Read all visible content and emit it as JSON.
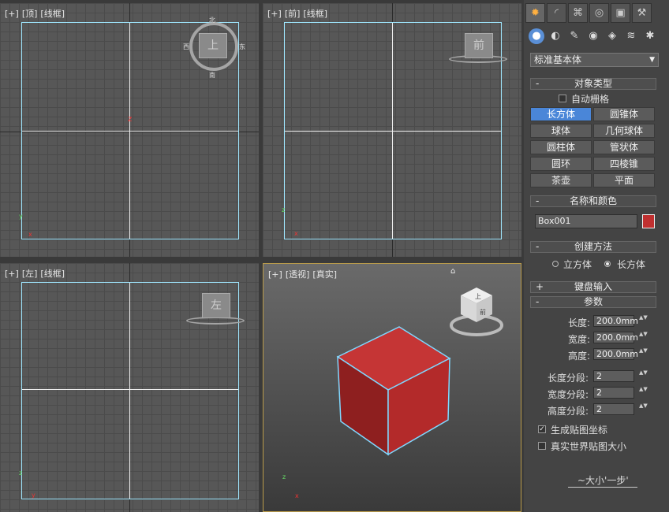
{
  "viewports": {
    "top": {
      "plus": "[+]",
      "view": "[顶]",
      "mode": "[线框]",
      "cube": "上",
      "n": "北",
      "s": "南",
      "w": "西",
      "e": "东"
    },
    "front": {
      "plus": "[+]",
      "view": "[前]",
      "mode": "[线框]",
      "cube": "前"
    },
    "left": {
      "plus": "[+]",
      "view": "[左]",
      "mode": "[线框]",
      "cube": "左"
    },
    "persp": {
      "plus": "[+]",
      "view": "[透视]",
      "mode": "[真实]",
      "cube_top": "上",
      "cube_front": "前"
    }
  },
  "axes": {
    "x": "x",
    "y": "y",
    "z": "z"
  },
  "panel": {
    "tab_icons": [
      "sun-icon",
      "arc-icon",
      "hierarchy-icon",
      "motion-icon",
      "display-icon",
      "hammer-icon"
    ],
    "subtab_icons": [
      "sphere-icon",
      "shapes-icon",
      "light-icon",
      "camera-icon",
      "helper-icon",
      "spacewarp-icon",
      "system-icon"
    ],
    "dropdown": "标准基本体",
    "object_type": {
      "title": "对象类型",
      "autogrid": "自动栅格",
      "buttons": [
        "长方体",
        "圆锥体",
        "球体",
        "几何球体",
        "圆柱体",
        "管状体",
        "圆环",
        "四棱锥",
        "茶壶",
        "平面"
      ]
    },
    "name_color": {
      "title": "名称和颜色",
      "name": "Box001",
      "color": "#c03030"
    },
    "creation": {
      "title": "创建方法",
      "opt1": "立方体",
      "opt2": "长方体"
    },
    "keyboard": {
      "title": "键盘输入"
    },
    "params": {
      "title": "参数",
      "length_label": "长度:",
      "length": "200.0mm",
      "width_label": "宽度:",
      "width": "200.0mm",
      "height_label": "高度:",
      "height": "200.0mm",
      "lseg_label": "长度分段:",
      "lseg": "2",
      "wseg_label": "宽度分段:",
      "wseg": "2",
      "hseg_label": "高度分段:",
      "hseg": "2",
      "gen_uv": "生成贴图坐标",
      "real_world": "真实世界贴图大小"
    },
    "watermark": "~大小'一步'"
  },
  "colors": {
    "frame": "#9fe7ff",
    "accent": "#4a86d8",
    "box": "#c03030"
  }
}
